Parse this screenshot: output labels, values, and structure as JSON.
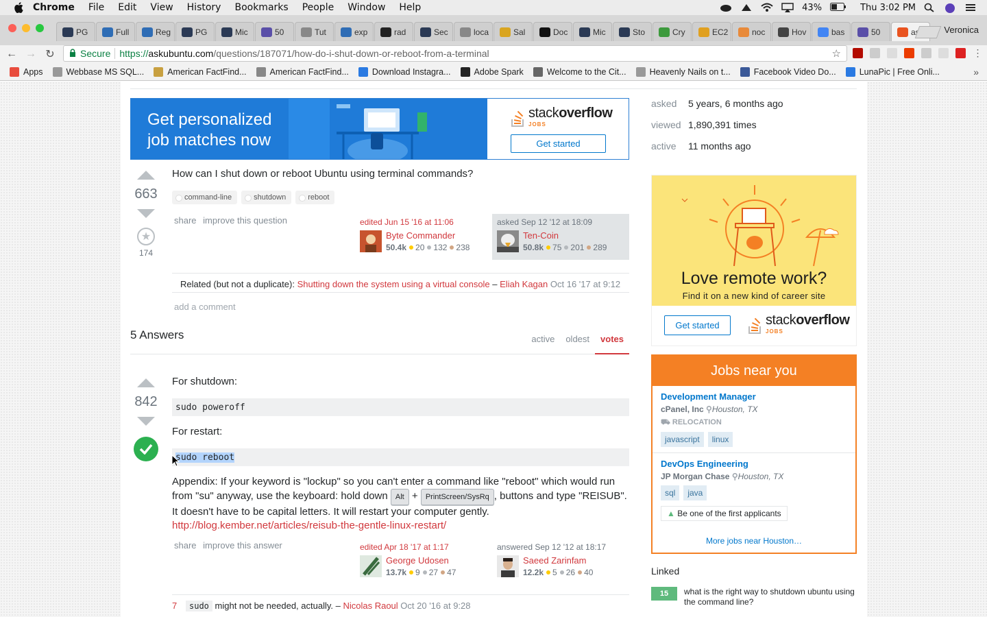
{
  "menubar": {
    "app": "Chrome",
    "items": [
      "File",
      "Edit",
      "View",
      "History",
      "Bookmarks",
      "People",
      "Window",
      "Help"
    ],
    "battery": "43%",
    "clock": "Thu 3:02 PM"
  },
  "tabs": [
    {
      "label": "PG",
      "color": "#2b3a55"
    },
    {
      "label": "Full",
      "color": "#2f6db5"
    },
    {
      "label": "Reg",
      "color": "#2f6db5"
    },
    {
      "label": "PG",
      "color": "#2b3a55"
    },
    {
      "label": "Mic",
      "color": "#2b3a55"
    },
    {
      "label": "50",
      "color": "#5a4fa8"
    },
    {
      "label": "Tut",
      "color": "#888888"
    },
    {
      "label": "exp",
      "color": "#2f6db5"
    },
    {
      "label": "rad",
      "color": "#222222"
    },
    {
      "label": "Sec",
      "color": "#2b3a55"
    },
    {
      "label": "loca",
      "color": "#888888"
    },
    {
      "label": "Sal",
      "color": "#d9a520"
    },
    {
      "label": "Doc",
      "color": "#111111"
    },
    {
      "label": "Mic",
      "color": "#2b3a55"
    },
    {
      "label": "Sto",
      "color": "#2b3a55"
    },
    {
      "label": "Cry",
      "color": "#3d9a3d"
    },
    {
      "label": "EC2",
      "color": "#e0a020"
    },
    {
      "label": "noc",
      "color": "#e88a3a"
    },
    {
      "label": "Hov",
      "color": "#444444"
    },
    {
      "label": "bas",
      "color": "#4285f4"
    },
    {
      "label": "50",
      "color": "#5a4fa8"
    },
    {
      "label": "ask",
      "color": "#e95420"
    }
  ],
  "profile": "Veronica",
  "address": {
    "secure": "Secure",
    "scheme": "https://",
    "host": "askubuntu.com",
    "path": "/questions/187071/how-do-i-shut-down-or-reboot-from-a-terminal"
  },
  "bookmarks": [
    {
      "label": "Apps",
      "color": "#e84c3d"
    },
    {
      "label": "Webbase MS SQL...",
      "color": "#999999"
    },
    {
      "label": "American FactFind...",
      "color": "#c8a040"
    },
    {
      "label": "American FactFind...",
      "color": "#888888"
    },
    {
      "label": "Download Instagra...",
      "color": "#2a7ae2"
    },
    {
      "label": "Adobe Spark",
      "color": "#222222"
    },
    {
      "label": "Welcome to the Cit...",
      "color": "#666666"
    },
    {
      "label": "Heavenly Nails on t...",
      "color": "#999999"
    },
    {
      "label": "Facebook Video Do...",
      "color": "#3b5998"
    },
    {
      "label": "LunaPic | Free Onli...",
      "color": "#2a7ae2"
    }
  ],
  "ad": {
    "line1": "Get personalized",
    "line2": "job matches now",
    "brand_a": "stack",
    "brand_b": "overflow",
    "brand_jobs": "JOBS",
    "cta": "Get started"
  },
  "question": {
    "votes": "663",
    "favorites": "174",
    "text": "How can I shut down or reboot Ubuntu using terminal commands?",
    "tags": [
      "command-line",
      "shutdown",
      "reboot"
    ],
    "menu": [
      "share",
      "improve this question"
    ],
    "edited": {
      "action": "edited Jun 15 '16 at 11:06",
      "name": "Byte Commander",
      "rep": "50.4k",
      "gold": "20",
      "silver": "132",
      "bronze": "238"
    },
    "asked": {
      "action": "asked Sep 12 '12 at 18:09",
      "name": "Ten-Coin",
      "rep": "50.8k",
      "gold": "75",
      "silver": "201",
      "bronze": "289"
    },
    "comment": {
      "prefix": "Related (but not a duplicate): ",
      "link": "Shutting down the system using a virtual console",
      "dash": " – ",
      "user": "Eliah Kagan",
      "date": " Oct 16 '17 at 9:12"
    },
    "add_comment": "add a comment"
  },
  "answers_header": {
    "count": "5 Answers",
    "tabs": [
      "active",
      "oldest",
      "votes"
    ]
  },
  "answer": {
    "votes": "842",
    "p1": "For shutdown:",
    "code1": "sudo poweroff",
    "p2": "For restart:",
    "code2": "sudo reboot",
    "appendix_a": "Appendix: If your keyword is \"lockup\" so you can't enter a command like \"reboot\" which would run from \"su\" anyway, use the keyboard: hold down ",
    "kbd1": "Alt",
    "plus": " + ",
    "kbd2": "PrintScreen/SysRq",
    "appendix_b": ", buttons and type \"REISUB\". It doesn't have to be capital letters. It will restart your computer gently.",
    "link": "http://blog.kember.net/articles/reisub-the-gentle-linux-restart/",
    "menu": [
      "share",
      "improve this answer"
    ],
    "edited": {
      "action": "edited Apr 18 '17 at 1:17",
      "name": "George Udosen",
      "rep": "13.7k",
      "gold": "9",
      "silver": "27",
      "bronze": "47"
    },
    "answered": {
      "action": "answered Sep 12 '12 at 18:17",
      "name": "Saeed Zarinfam",
      "rep": "12.2k",
      "gold": "5",
      "silver": "26",
      "bronze": "40"
    },
    "comment": {
      "score": "7",
      "code": "sudo",
      "text": " might not be needed, actually. – ",
      "user": "Nicolas Raoul",
      "date": " Oct 20 '16 at 9:28"
    }
  },
  "sidebar": {
    "asked_k": "asked",
    "asked_v": "5 years, 6 months ago",
    "viewed_k": "viewed",
    "viewed_v": "1,890,391 times",
    "active_k": "active",
    "active_v": "11 months ago",
    "remote_big": "Love remote work?",
    "remote_small": "Find it on a new kind of career site",
    "remote_cta": "Get started",
    "jobs_title": "Jobs near you",
    "job1": {
      "title": "Development Manager",
      "company": "cPanel, Inc",
      "location": "Houston, TX",
      "reloc": "RELOCATION",
      "tags": [
        "javascript",
        "linux"
      ]
    },
    "job2": {
      "title": "DevOps Engineering",
      "company": "JP Morgan Chase",
      "location": "Houston, TX",
      "tags": [
        "sql",
        "java"
      ],
      "hint": "Be one of the first applicants"
    },
    "more_jobs": "More jobs near Houston…",
    "linked_title": "Linked",
    "linked": {
      "score": "15",
      "text": "what is the right way to shutdown ubuntu using the command line?"
    }
  }
}
